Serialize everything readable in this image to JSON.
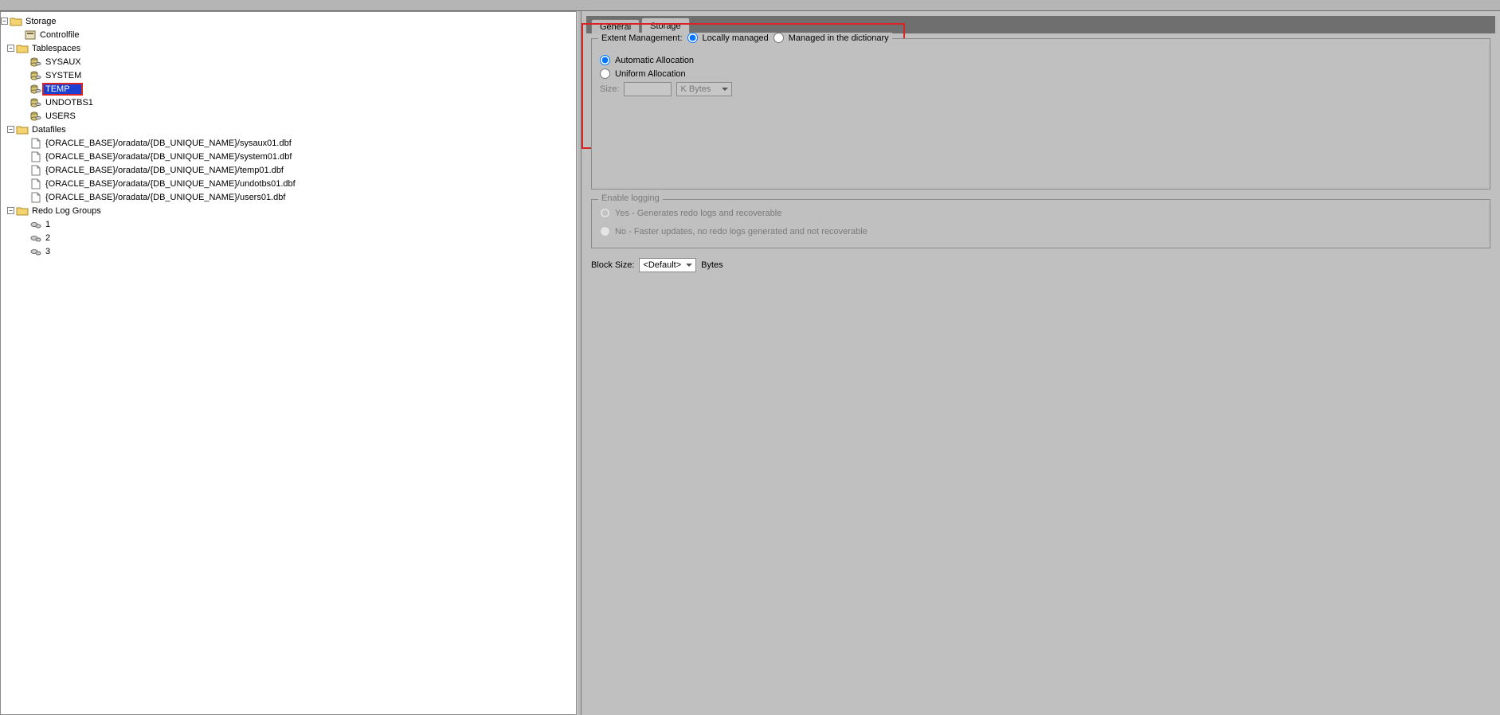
{
  "tree": {
    "root": "Storage",
    "controlfile": "Controlfile",
    "tablespaces": "Tablespaces",
    "ts_items": [
      "SYSAUX",
      "SYSTEM",
      "TEMP",
      "UNDOTBS1",
      "USERS"
    ],
    "ts_selected": "TEMP",
    "datafiles": "Datafiles",
    "df_items": [
      "{ORACLE_BASE}/oradata/{DB_UNIQUE_NAME}/sysaux01.dbf",
      "{ORACLE_BASE}/oradata/{DB_UNIQUE_NAME}/system01.dbf",
      "{ORACLE_BASE}/oradata/{DB_UNIQUE_NAME}/temp01.dbf",
      "{ORACLE_BASE}/oradata/{DB_UNIQUE_NAME}/undotbs01.dbf",
      "{ORACLE_BASE}/oradata/{DB_UNIQUE_NAME}/users01.dbf"
    ],
    "redolog": "Redo Log Groups",
    "rl_items": [
      "1",
      "2",
      "3"
    ]
  },
  "tabs": {
    "general": "General",
    "storage": "Storage"
  },
  "extent": {
    "legend": "Extent Management:",
    "locally": "Locally managed",
    "dictionary": "Managed in the dictionary",
    "auto": "Automatic Allocation",
    "uniform": "Uniform Allocation",
    "size_label": "Size:",
    "size_value": "",
    "size_unit": "K Bytes"
  },
  "logging": {
    "legend": "Enable logging",
    "yes": "Yes - Generates redo logs and recoverable",
    "no": "No - Faster updates, no redo logs generated and not recoverable"
  },
  "block": {
    "label": "Block Size:",
    "value": "<Default>",
    "unit": "Bytes"
  }
}
